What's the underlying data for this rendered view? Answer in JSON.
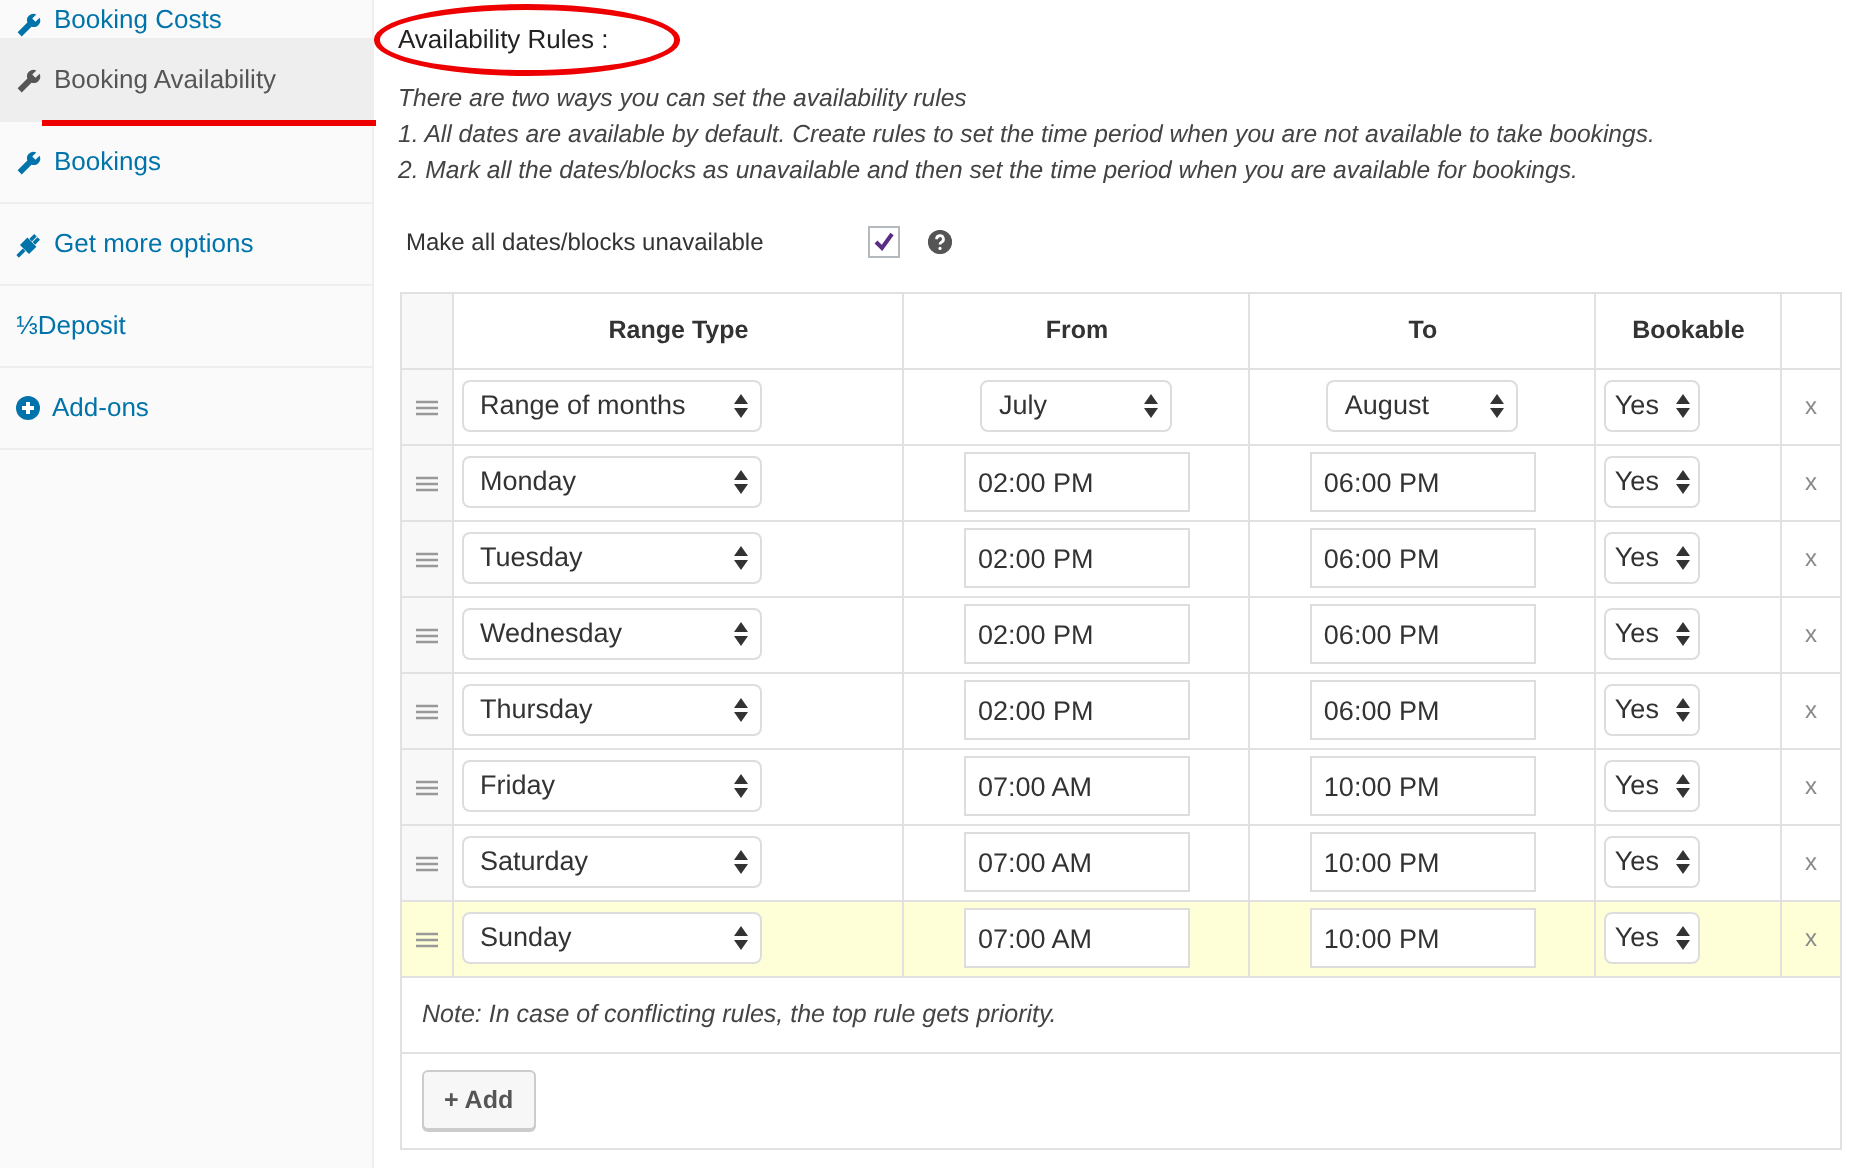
{
  "sidebar": {
    "items": [
      {
        "label": "Booking Costs",
        "kind": "wrench",
        "selected": false,
        "underlined": false
      },
      {
        "label": "Booking Availability",
        "kind": "wrench",
        "selected": true,
        "underlined": true
      },
      {
        "label": "Bookings",
        "kind": "wrench",
        "selected": false,
        "underlined": false
      },
      {
        "label": "Get more options",
        "kind": "plug",
        "selected": false,
        "underlined": false
      },
      {
        "label": "⅓Deposit",
        "kind": "plain",
        "selected": false,
        "underlined": false
      },
      {
        "label": "Add-ons",
        "kind": "addon",
        "selected": false,
        "underlined": false
      }
    ]
  },
  "heading": {
    "text": "Availability Rules :",
    "circled": true
  },
  "intro": [
    "There are two ways you can set the availability rules",
    "1. All dates are available by default. Create rules to set the time period when you are not available to take bookings.",
    "2. Mark all the dates/blocks as unavailable and then set the time period when you are available for bookings."
  ],
  "option": {
    "label": "Make all dates/blocks unavailable",
    "checked": true
  },
  "table": {
    "columns": [
      "Range Type",
      "From",
      "To",
      "Bookable"
    ],
    "rows": [
      {
        "range_type": "Range of months",
        "from": {
          "kind": "select",
          "value": "July"
        },
        "to": {
          "kind": "select",
          "value": "August"
        },
        "bookable": "Yes",
        "remove": "x",
        "highlighted": false
      },
      {
        "range_type": "Monday",
        "from": {
          "kind": "time",
          "value": "02:00 PM"
        },
        "to": {
          "kind": "time",
          "value": "06:00 PM"
        },
        "bookable": "Yes",
        "remove": "x",
        "highlighted": false
      },
      {
        "range_type": "Tuesday",
        "from": {
          "kind": "time",
          "value": "02:00 PM"
        },
        "to": {
          "kind": "time",
          "value": "06:00 PM"
        },
        "bookable": "Yes",
        "remove": "x",
        "highlighted": false
      },
      {
        "range_type": "Wednesday",
        "from": {
          "kind": "time",
          "value": "02:00 PM"
        },
        "to": {
          "kind": "time",
          "value": "06:00 PM"
        },
        "bookable": "Yes",
        "remove": "x",
        "highlighted": false
      },
      {
        "range_type": "Thursday",
        "from": {
          "kind": "time",
          "value": "02:00 PM"
        },
        "to": {
          "kind": "time",
          "value": "06:00 PM"
        },
        "bookable": "Yes",
        "remove": "x",
        "highlighted": false
      },
      {
        "range_type": "Friday",
        "from": {
          "kind": "time",
          "value": "07:00 AM"
        },
        "to": {
          "kind": "time",
          "value": "10:00 PM"
        },
        "bookable": "Yes",
        "remove": "x",
        "highlighted": false
      },
      {
        "range_type": "Saturday",
        "from": {
          "kind": "time",
          "value": "07:00 AM"
        },
        "to": {
          "kind": "time",
          "value": "10:00 PM"
        },
        "bookable": "Yes",
        "remove": "x",
        "highlighted": false
      },
      {
        "range_type": "Sunday",
        "from": {
          "kind": "time",
          "value": "07:00 AM"
        },
        "to": {
          "kind": "time",
          "value": "10:00 PM"
        },
        "bookable": "Yes",
        "remove": "x",
        "highlighted": true
      }
    ],
    "note": "Note: In case of conflicting rules, the top rule gets priority.",
    "add_button": "+ Add"
  }
}
